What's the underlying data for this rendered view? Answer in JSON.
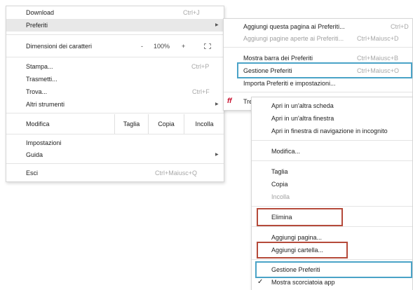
{
  "main_menu": {
    "download": {
      "label": "Download",
      "shortcut": "Ctrl+J"
    },
    "preferiti": {
      "label": "Preferiti"
    },
    "font_size": {
      "label": "Dimensioni dei caratteri",
      "minus": "-",
      "zoom": "100%",
      "plus": "+"
    },
    "stampa": {
      "label": "Stampa...",
      "shortcut": "Ctrl+P"
    },
    "trasmetti": {
      "label": "Trasmetti..."
    },
    "trova": {
      "label": "Trova...",
      "shortcut": "Ctrl+F"
    },
    "altri_strumenti": {
      "label": "Altri strumenti"
    },
    "edit": {
      "label": "Modifica",
      "cut": "Taglia",
      "copy": "Copia",
      "paste": "Incolla"
    },
    "impostazioni": {
      "label": "Impostazioni"
    },
    "guida": {
      "label": "Guida"
    },
    "esci": {
      "label": "Esci",
      "shortcut": "Ctrl+Maiusc+Q"
    }
  },
  "bookmarks_menu": {
    "add_page": {
      "label": "Aggiungi questa pagina ai Preferiti...",
      "shortcut": "Ctrl+D"
    },
    "add_open": {
      "label": "Aggiungi pagine aperte ai Preferiti...",
      "shortcut": "Ctrl+Maiusc+D"
    },
    "show_bar": {
      "label": "Mostra barra dei Preferiti",
      "shortcut": "Ctrl+Maiusc+B"
    },
    "manage": {
      "label": "Gestione Preferiti",
      "shortcut": "Ctrl+Maiusc+O"
    },
    "import": {
      "label": "Importa Preferiti e impostazioni..."
    },
    "trenitalia_item": {
      "label": "Tre"
    }
  },
  "context_menu": {
    "items": [
      "Apri in un'altra scheda",
      "Apri in un'altra finestra",
      "Apri in finestra di navigazione in incognito",
      "Modifica...",
      "Taglia",
      "Copia",
      "Incolla",
      "Elimina",
      "Aggiungi pagina...",
      "Aggiungi cartella...",
      "Gestione Preferiti",
      "Mostra scorciatoia app"
    ],
    "checkmark": "✓"
  },
  "colors": {
    "highlight_box": "#4aa3c7",
    "delete_box": "#b54a3a",
    "trenitalia_logo": "#c8102e"
  }
}
